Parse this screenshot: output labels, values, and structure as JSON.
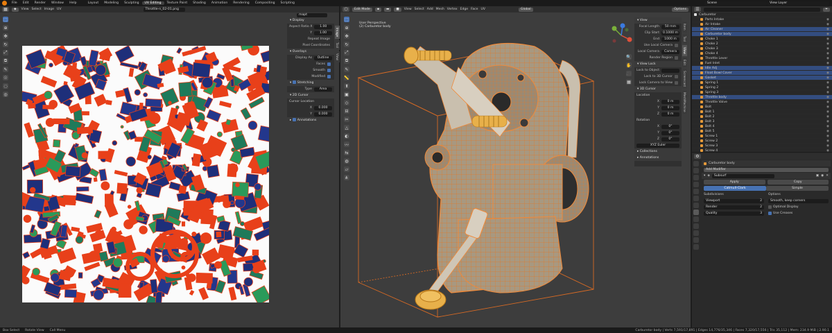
{
  "topbar": {
    "menus": [
      "File",
      "Edit",
      "Render",
      "Window",
      "Help"
    ],
    "workspaces": [
      "Layout",
      "Modeling",
      "Sculpting",
      "UV Editing",
      "Texture Paint",
      "Shading",
      "Animation",
      "Rendering",
      "Compositing",
      "Scripting"
    ],
    "active_workspace": "UV Editing",
    "scene": "Scene",
    "view_layer": "View Layer"
  },
  "uv_editor": {
    "menus": [
      "View",
      "Select",
      "Image",
      "UV"
    ],
    "image_name": "Throttle-n_02-01.png",
    "tabs": [
      "Image",
      "Tool",
      "View"
    ],
    "display": {
      "header": "Display",
      "aspect_ratio_label": "Aspect Ratio X",
      "aspect_x": "1.00",
      "y_label": "Y",
      "aspect_y": "1.00",
      "repeat_image": "Repeat Image",
      "pixel_coordinates": "Pixel Coordinates"
    },
    "overlays": {
      "header": "Overlays",
      "display_as_label": "Display As",
      "display_as": "Outline",
      "faces": "Faces",
      "smooth": "Smooth",
      "modified": "Modified"
    },
    "stretching": {
      "header": "Stretching",
      "type_label": "Type",
      "type": "Area"
    },
    "cursor2d": {
      "header": "2D Cursor",
      "location_label": "Cursor Location",
      "x_label": "X",
      "x": "0.000",
      "y_label": "Y",
      "y": "0.000"
    },
    "annotations": "Annotations",
    "search_placeholder": "mapt"
  },
  "viewport": {
    "mode": "Edit Mode",
    "menus": [
      "View",
      "Select",
      "Add",
      "Mesh",
      "Vertex",
      "Edge",
      "Face",
      "UV"
    ],
    "transform": "Global",
    "options": "Options",
    "info_line1": "User Perspective",
    "info_line2": "(2) Carburetor body",
    "tabs": [
      "Item",
      "Tool",
      "View",
      "Edit",
      "Screencast",
      "MeshMachine"
    ],
    "view_panel": {
      "header": "View",
      "focal_label": "Focal Length",
      "focal": "50 mm",
      "clip_start_label": "Clip Start",
      "clip_start": "0.1000 m",
      "end_label": "End",
      "end": "1000 m",
      "use_local_camera": "Use Local Camera",
      "local_camera_label": "Local Camera",
      "local_camera": "Camera",
      "render_region": "Render Region"
    },
    "view_lock": {
      "header": "View Lock",
      "lock_to_object": "Lock to Object",
      "lock_to_3d_cursor": "Lock to 3D Cursor",
      "lock_camera_to_view": "Lock Camera to View"
    },
    "cursor3d": {
      "header": "3D Cursor",
      "location_label": "Location",
      "x_label": "X",
      "x": "0 m",
      "y_label": "Y",
      "y": "0 m",
      "z_label": "Z",
      "z": "0 m",
      "rotation_label": "Rotation",
      "rx_label": "X",
      "rx": "0°",
      "ry_label": "Y",
      "ry": "0°",
      "rz_label": "Z",
      "rz": "0°",
      "mode_label": "XYZ Euler"
    },
    "collections": "Collections",
    "annotations": "Annotations"
  },
  "outliner": {
    "root": "Carburetor",
    "items": [
      {
        "name": "Parts Intake",
        "sel": false
      },
      {
        "name": "Air Intake",
        "sel": false
      },
      {
        "name": "Air Cleaner",
        "sel": true
      },
      {
        "name": "Carburetor body",
        "sel": true
      },
      {
        "name": "Choke 1",
        "sel": false
      },
      {
        "name": "Choke 2",
        "sel": false
      },
      {
        "name": "Choke 3",
        "sel": false
      },
      {
        "name": "Choke 4",
        "sel": false
      },
      {
        "name": "Throttle Lever",
        "sel": false
      },
      {
        "name": "Fuel Inlet",
        "sel": false
      },
      {
        "name": "Idle Adj",
        "sel": true
      },
      {
        "name": "Float Bowl Cover",
        "sel": true
      },
      {
        "name": "Gasket",
        "sel": true
      },
      {
        "name": "Spring 1",
        "sel": false
      },
      {
        "name": "Spring 2",
        "sel": false
      },
      {
        "name": "Spring 3",
        "sel": false
      },
      {
        "name": "Throttle body",
        "sel": true
      },
      {
        "name": "Throttle Valve",
        "sel": false
      },
      {
        "name": "Bolt",
        "sel": false
      },
      {
        "name": "Bolt 1",
        "sel": false
      },
      {
        "name": "Bolt 2",
        "sel": false
      },
      {
        "name": "Bolt 3",
        "sel": false
      },
      {
        "name": "Bolt 4",
        "sel": false
      },
      {
        "name": "Bolt 5",
        "sel": false
      },
      {
        "name": "Screw 1",
        "sel": false
      },
      {
        "name": "Screw 2",
        "sel": false
      },
      {
        "name": "Screw 3",
        "sel": false
      },
      {
        "name": "Screw 4",
        "sel": false
      },
      {
        "name": "Screw 5",
        "sel": false
      },
      {
        "name": "Screw 6",
        "sel": false
      }
    ]
  },
  "properties": {
    "object_name": "Carburetor body",
    "add_modifier": "Add Modifier",
    "modifier_name": "Subsurf",
    "apply": "Apply",
    "copy": "Copy",
    "catmull_clark": "Catmull-Clark",
    "simple": "Simple",
    "subdivisions_label": "Subdivisions",
    "viewport_label": "Viewport",
    "viewport": "2",
    "render_label": "Render",
    "render": "2",
    "quality_label": "Quality",
    "quality": "3",
    "options_label": "Options",
    "smooth_uvs": "Smooth, keep corners",
    "optimal_display": "Optimal Display",
    "use_creases": "Use Creases"
  },
  "statusbar": {
    "left1": "Box Select",
    "left2": "Rotate View",
    "left3": "Call Menu",
    "right": "Carburetor body | Verts 7,591/17,891 | Edges 14,776/35,346 | Faces 7,320/17,556 | Tris 35,112 | Mem: 234.9 MiB | 2.90.1"
  },
  "colors": {
    "accent": "#4772b3",
    "blender_orange": "#e87d0d",
    "uv_island": "#e8401a",
    "uv_face": "#1e2f7a"
  }
}
